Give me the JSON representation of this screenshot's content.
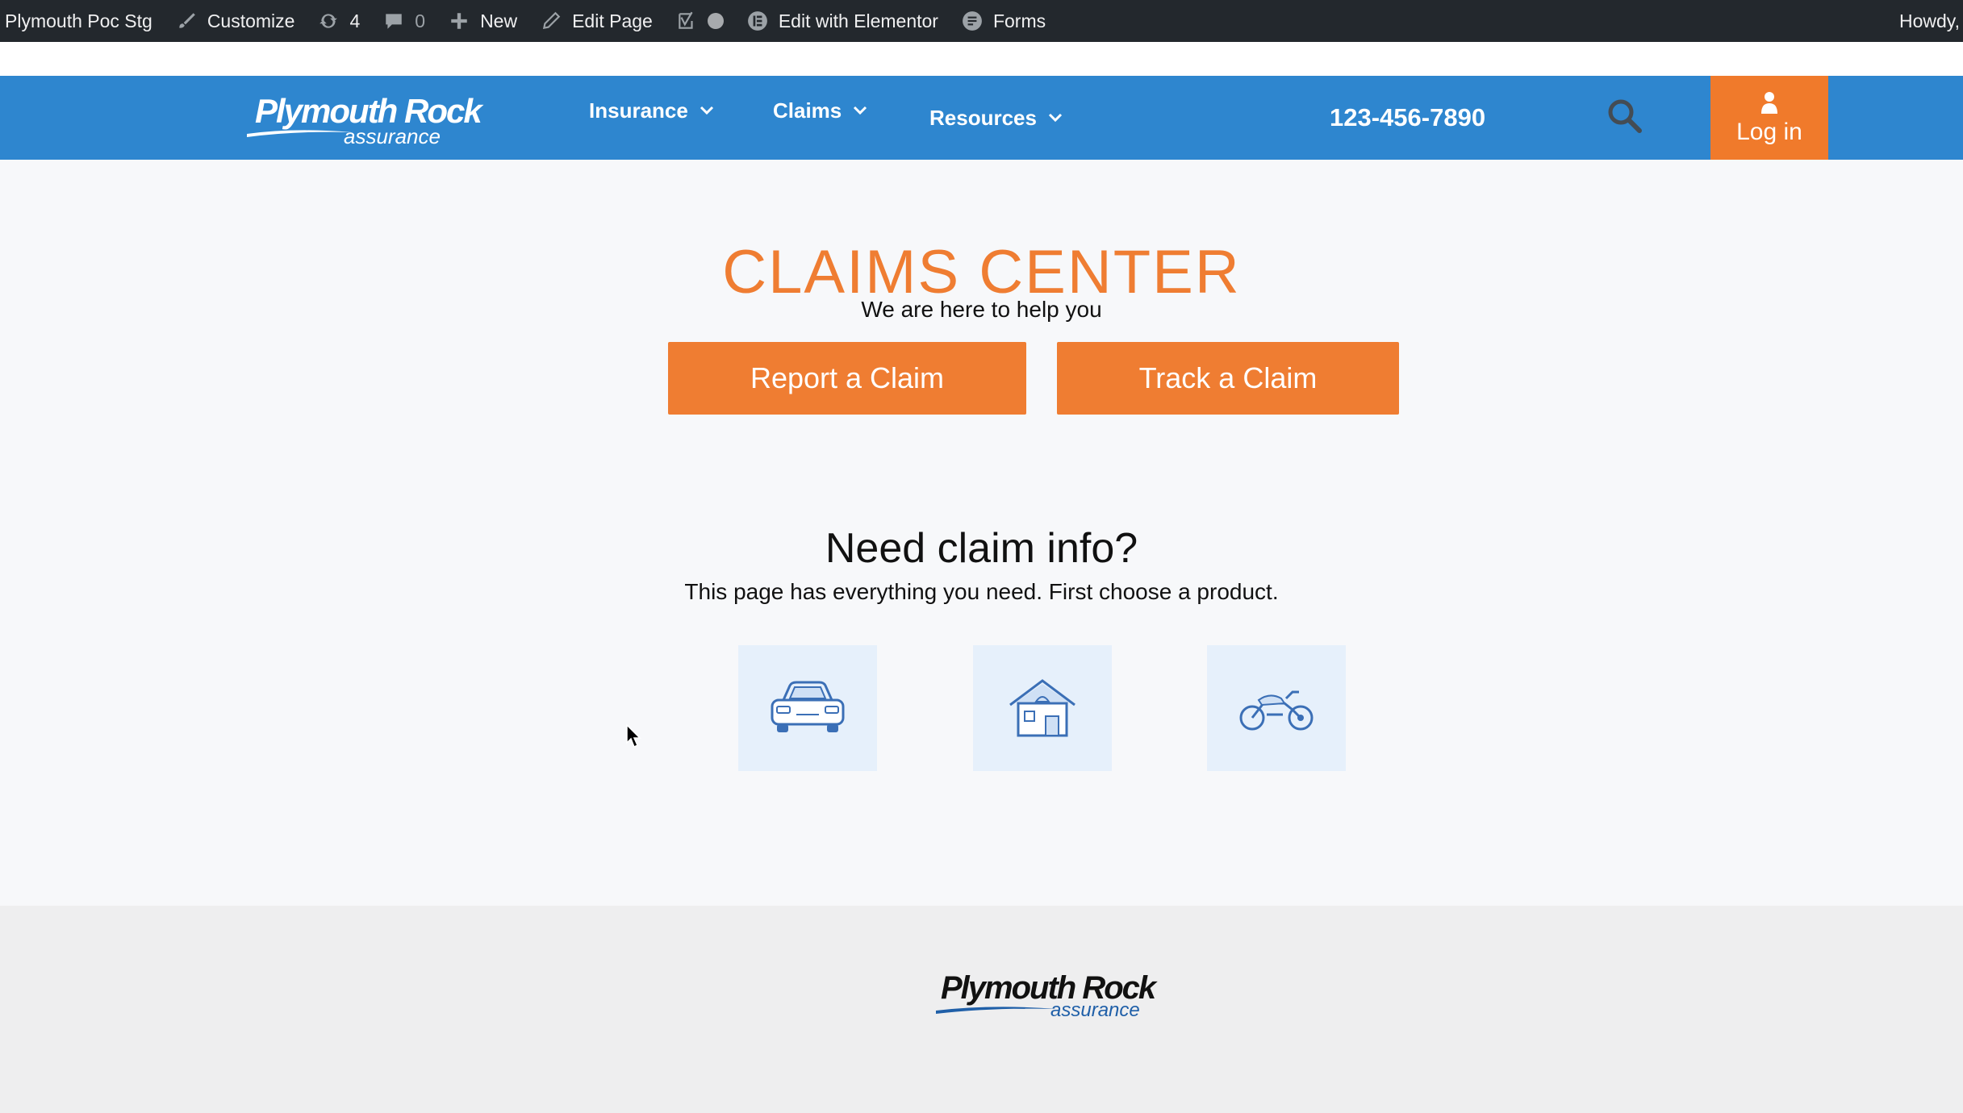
{
  "admin_bar": {
    "site_name": "Plymouth Poc Stg",
    "customize": "Customize",
    "updates_count": "4",
    "comments_count": "0",
    "new": "New",
    "edit_page": "Edit Page",
    "edit_elementor": "Edit with Elementor",
    "forms": "Forms",
    "howdy": "Howdy,"
  },
  "header": {
    "logo_main": "Plymouth Rock",
    "logo_sub": "assurance",
    "nav": [
      {
        "label": "Insurance"
      },
      {
        "label": "Claims"
      },
      {
        "label": "Resources"
      }
    ],
    "phone": "123-456-7890",
    "login_label": "Log in"
  },
  "hero": {
    "title": "CLAIMS CENTER",
    "subtitle": "We are here to help you",
    "report_button": "Report a Claim",
    "track_button": "Track a Claim"
  },
  "info": {
    "title": "Need claim info?",
    "subtitle": "This page has everything you need. First choose a product.",
    "products": [
      {
        "icon": "car-icon"
      },
      {
        "icon": "house-icon"
      },
      {
        "icon": "motorcycle-icon"
      }
    ]
  },
  "footer": {
    "logo_main": "Plymouth Rock",
    "logo_sub": "assurance"
  },
  "colors": {
    "header_blue": "#2e86cf",
    "accent_orange": "#ef7d32",
    "admin_bar": "#23282d",
    "icon_blue": "#3b6fb6"
  }
}
